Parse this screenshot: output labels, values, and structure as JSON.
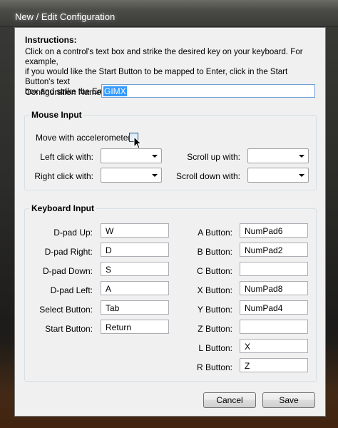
{
  "window": {
    "title": "New / Edit Configuration"
  },
  "instructions": {
    "heading": "Instructions:",
    "line1": "Click on a control's text box and strike the desired key on your keyboard. For example,",
    "line2": "if you would like the Start Button to be mapped to Enter, click in the Start Button's text",
    "line3": "box and strike the Enter key."
  },
  "config": {
    "label": "Configuration Name:",
    "value": "GIMX"
  },
  "mouse": {
    "title": "Mouse Input",
    "accel_label": "Move with accelerometer:",
    "accel_checked": false,
    "left_click": "Left click with:",
    "right_click": "Right click with:",
    "scroll_up": "Scroll up with:",
    "scroll_down": "Scroll down with:"
  },
  "keyboard": {
    "title": "Keyboard Input",
    "left_rows": [
      {
        "label": "D-pad Up:",
        "value": "W"
      },
      {
        "label": "D-pad Right:",
        "value": "D"
      },
      {
        "label": "D-pad Down:",
        "value": "S"
      },
      {
        "label": "D-pad Left:",
        "value": "A"
      },
      {
        "label": "Select Button:",
        "value": "Tab"
      },
      {
        "label": "Start Button:",
        "value": "Return"
      }
    ],
    "right_rows": [
      {
        "label": "A Button:",
        "value": "NumPad6"
      },
      {
        "label": "B Button:",
        "value": "NumPad2"
      },
      {
        "label": "C Button:",
        "value": ""
      },
      {
        "label": "X Button:",
        "value": "NumPad8"
      },
      {
        "label": "Y Button:",
        "value": "NumPad4"
      },
      {
        "label": "Z Button:",
        "value": ""
      },
      {
        "label": "L Button:",
        "value": "X"
      },
      {
        "label": "R Button:",
        "value": "Z"
      }
    ]
  },
  "buttons": {
    "cancel": "Cancel",
    "save": "Save"
  }
}
